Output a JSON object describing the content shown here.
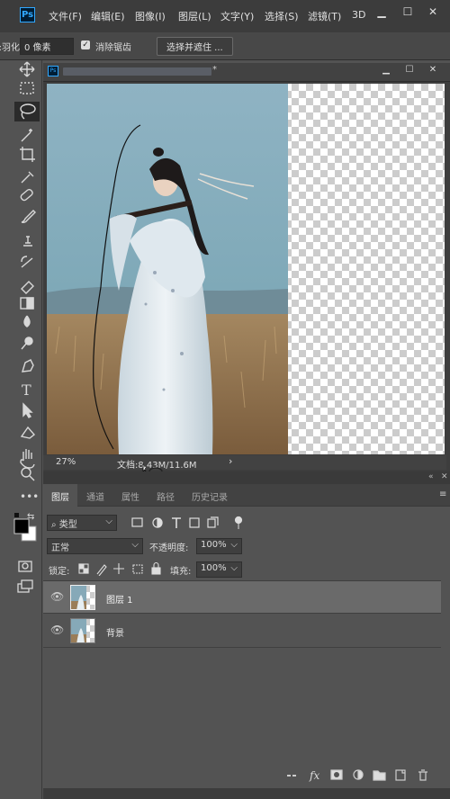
{
  "menubar": {
    "logo": "Ps",
    "items": [
      "文件(F)",
      "编辑(E)",
      "图像(I)",
      "图层(L)",
      "文字(Y)",
      "选择(S)",
      "滤镜(T)",
      "3D"
    ],
    "window_controls": [
      "minimize",
      "maximize",
      "close"
    ]
  },
  "options_bar": {
    "feather_label": "羽化:",
    "feather_value": "0 像素",
    "antialias_label": "消除锯齿",
    "select_mask_button": "选择并遮住 ..."
  },
  "document": {
    "tab_title": "",
    "zoom": "27%",
    "doc_info": "文档:8.43M/11.6M",
    "status_arrow": "›"
  },
  "layers_panel": {
    "tabs": [
      "图层",
      "通道",
      "属性",
      "路径",
      "历史记录"
    ],
    "active_tab": "图层",
    "filter_kind": "类型",
    "blend_mode": "正常",
    "opacity_label": "不透明度:",
    "opacity_value": "100%",
    "lock_label": "锁定:",
    "fill_label": "填充:",
    "fill_value": "100%",
    "layers": [
      {
        "name": "图层 1",
        "selected": true,
        "visible": true
      },
      {
        "name": "背景",
        "selected": false,
        "visible": true
      }
    ]
  },
  "colors": {
    "ps_blue": "#31a8ff",
    "menubar_bg": "#3c3c3c",
    "panel_bg": "#535353",
    "selected_layer": "#6a6a6a"
  }
}
